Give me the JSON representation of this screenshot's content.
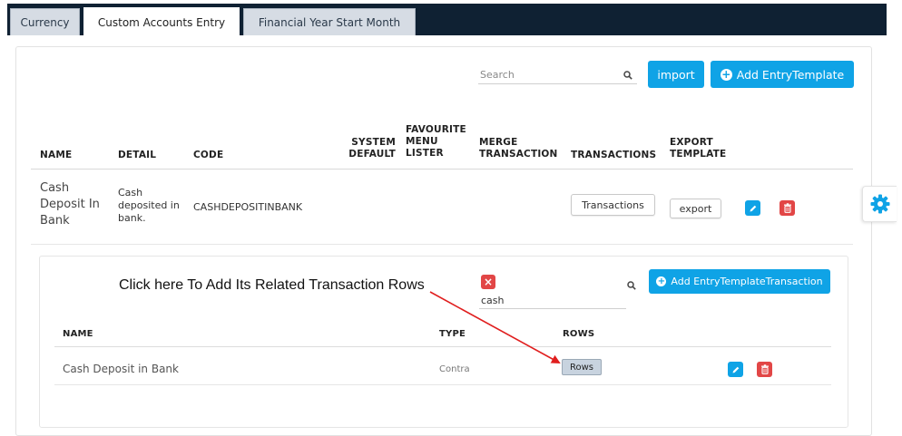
{
  "tabs": [
    {
      "label": "Currency"
    },
    {
      "label": "Custom Accounts Entry"
    },
    {
      "label": "Financial Year Start Month"
    }
  ],
  "active_tab": "Custom Accounts Entry",
  "colors": {
    "accent": "#0fa3e6",
    "danger": "#e24646",
    "topbar": "#0f2133",
    "annotation_arrow": "#e01e1e"
  },
  "toolbar": {
    "search_placeholder": "Search",
    "import_label": "import",
    "add_template_label": "Add EntryTemplate"
  },
  "table": {
    "headers": {
      "name": "NAME",
      "detail": "DETAIL",
      "code": "CODE",
      "system_default_1": "SYSTEM",
      "system_default_2": "DEFAULT",
      "favourite_1": "FAVOURITE",
      "favourite_2": "MENU",
      "favourite_3": "LISTER",
      "merge_1": "MERGE",
      "merge_2": "TRANSACTION",
      "transactions": "TRANSACTIONS",
      "export_1": "EXPORT",
      "export_2": "TEMPLATE"
    },
    "row": {
      "name_1": "Cash",
      "name_2": "Deposit In",
      "name_3": "Bank",
      "detail_1": "Cash",
      "detail_2": "deposited in",
      "detail_3": "bank.",
      "code": "CASHDEPOSITINBANK",
      "transactions_button": "Transactions",
      "export_button": "export"
    }
  },
  "sub_panel": {
    "annotation": "Click here To Add Its Related Transaction Rows",
    "search_value": "cash",
    "add_button": "Add EntryTemplateTransaction",
    "headers": {
      "name": "NAME",
      "type": "TYPE",
      "rows": "ROWS"
    },
    "row": {
      "name": "Cash Deposit in Bank",
      "type": "Contra",
      "rows_button": "Rows"
    }
  },
  "icons": [
    "search-icon",
    "plus-circle-icon",
    "pencil-icon",
    "trash-icon",
    "gear-icon",
    "close-icon"
  ]
}
